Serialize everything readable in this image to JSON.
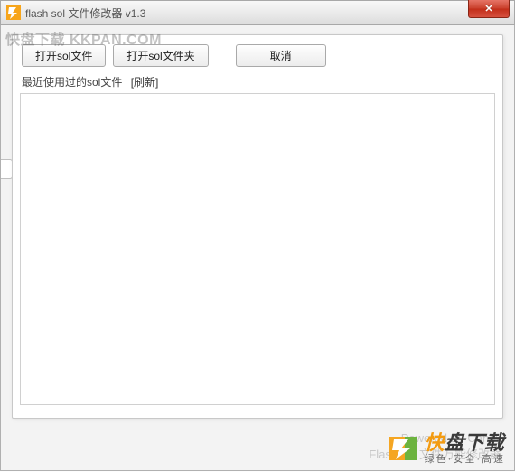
{
  "window": {
    "title": "flash sol 文件修改器 v1.3",
    "close_label": "✕"
  },
  "watermark": {
    "top": "快盘下载 KKPAN.COM"
  },
  "toolbar": {
    "open_file": "打开sol文件",
    "open_folder": "打开sol文件夹",
    "cancel": "取消"
  },
  "recent": {
    "label": "最近使用过的sol文件",
    "refresh": "[刷新]"
  },
  "ghost_footer": {
    "line1": "Powered By Candy",
    "line2": "Flash sol 文件万能修改器"
  },
  "brand": {
    "highlight": "快",
    "rest": "盘下载",
    "sub": "绿色·安全·高速"
  }
}
